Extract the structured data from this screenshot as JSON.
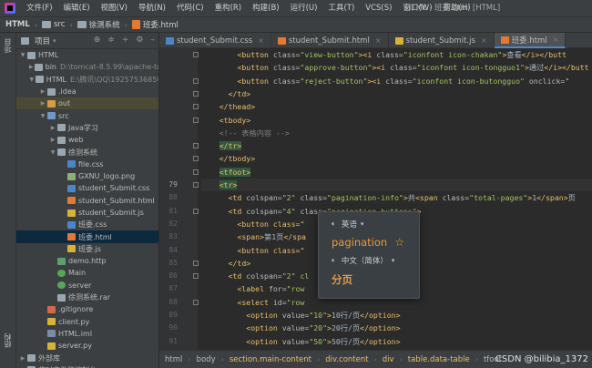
{
  "menubar": {
    "items": [
      "文件(F)",
      "编辑(E)",
      "视图(V)",
      "导航(N)",
      "代码(C)",
      "重构(R)",
      "构建(B)",
      "运行(U)",
      "工具(T)",
      "VCS(S)",
      "窗口(W)",
      "帮助(H)"
    ],
    "window_title": "HTML - 班委.html [HTML]"
  },
  "breadcrumb": [
    "HTML",
    "src",
    "徐测系统",
    "班委.html"
  ],
  "left_strip": {
    "top_label": "项目",
    "bottom_label": "结构"
  },
  "project_panel": {
    "title": "项目",
    "tree": [
      {
        "indent": 0,
        "arrow": "▼",
        "icon": "folder",
        "label": "HTML",
        "extra": "",
        "state": ""
      },
      {
        "indent": 1,
        "arrow": "▶",
        "icon": "folder",
        "label": "bin",
        "extra": "D:\\tomcat-8.5.99\\apache-to",
        "state": ""
      },
      {
        "indent": 1,
        "arrow": "▼",
        "icon": "folder",
        "label": "HTML",
        "extra": "E:\\腾讯\\QQ\\1925753685\\",
        "state": ""
      },
      {
        "indent": 2,
        "arrow": "▶",
        "icon": "folder",
        "label": ".idea",
        "extra": "",
        "state": ""
      },
      {
        "indent": 2,
        "arrow": "▶",
        "icon": "folder-orange",
        "label": "out",
        "extra": "",
        "state": "hl"
      },
      {
        "indent": 2,
        "arrow": "▼",
        "icon": "folder-blue",
        "label": "src",
        "extra": "",
        "state": ""
      },
      {
        "indent": 3,
        "arrow": "▶",
        "icon": "folder",
        "label": "Java学习",
        "extra": "",
        "state": ""
      },
      {
        "indent": 3,
        "arrow": "▶",
        "icon": "folder",
        "label": "web",
        "extra": "",
        "state": ""
      },
      {
        "indent": 3,
        "arrow": "▼",
        "icon": "folder",
        "label": "徐测系统",
        "extra": "",
        "state": ""
      },
      {
        "indent": 4,
        "arrow": "",
        "icon": "css",
        "label": "file.css",
        "extra": "",
        "state": ""
      },
      {
        "indent": 4,
        "arrow": "",
        "icon": "png",
        "label": "GXNU_logo.png",
        "extra": "",
        "state": ""
      },
      {
        "indent": 4,
        "arrow": "",
        "icon": "css",
        "label": "student_Submit.css",
        "extra": "",
        "state": ""
      },
      {
        "indent": 4,
        "arrow": "",
        "icon": "html",
        "label": "student_Submit.html",
        "extra": "",
        "state": ""
      },
      {
        "indent": 4,
        "arrow": "",
        "icon": "js",
        "label": "student_Submit.js",
        "extra": "",
        "state": ""
      },
      {
        "indent": 4,
        "arrow": "",
        "icon": "css",
        "label": "班委.css",
        "extra": "",
        "state": ""
      },
      {
        "indent": 4,
        "arrow": "",
        "icon": "html",
        "label": "班委.html",
        "extra": "",
        "state": "selected"
      },
      {
        "indent": 4,
        "arrow": "",
        "icon": "js",
        "label": "班委.js",
        "extra": "",
        "state": ""
      },
      {
        "indent": 3,
        "arrow": "",
        "icon": "http",
        "label": "demo.http",
        "extra": "",
        "state": ""
      },
      {
        "indent": 3,
        "arrow": "",
        "icon": "run",
        "label": "Main",
        "extra": "",
        "state": ""
      },
      {
        "indent": 3,
        "arrow": "",
        "icon": "run",
        "label": "server",
        "extra": "",
        "state": ""
      },
      {
        "indent": 3,
        "arrow": "",
        "icon": "rar",
        "label": "徐测系统.rar",
        "extra": "",
        "state": ""
      },
      {
        "indent": 2,
        "arrow": "",
        "icon": "git",
        "label": ".gitignore",
        "extra": "",
        "state": ""
      },
      {
        "indent": 2,
        "arrow": "",
        "icon": "js",
        "label": "client.py",
        "extra": "",
        "state": ""
      },
      {
        "indent": 2,
        "arrow": "",
        "icon": "iml",
        "label": "HTML.iml",
        "extra": "",
        "state": ""
      },
      {
        "indent": 2,
        "arrow": "",
        "icon": "js",
        "label": "server.py",
        "extra": "",
        "state": ""
      },
      {
        "indent": 0,
        "arrow": "▶",
        "icon": "folder",
        "label": "外部库",
        "extra": "",
        "state": ""
      },
      {
        "indent": 0,
        "arrow": "",
        "icon": "folder",
        "label": "临时文件和控制台",
        "extra": "",
        "state": ""
      }
    ]
  },
  "tabs": [
    {
      "label": "student_Submit.css",
      "icon": "css",
      "active": false
    },
    {
      "label": "student_Submit.html",
      "icon": "html",
      "active": false
    },
    {
      "label": "student_Submit.js",
      "icon": "js",
      "active": false
    },
    {
      "label": "班委.html",
      "icon": "html",
      "active": true
    }
  ],
  "editor": {
    "current_line": 79,
    "line_numbers": [
      "",
      "",
      "",
      "",
      "",
      "",
      "",
      "",
      "",
      "",
      "79",
      "80",
      "81",
      "82",
      "83",
      "84",
      "85",
      "86",
      "87",
      "88",
      "89",
      "90",
      "91"
    ],
    "lines": [
      [
        [
          "        ",
          "tx"
        ],
        [
          "<button ",
          "tg"
        ],
        [
          "class=",
          "at"
        ],
        [
          "\"view-button\"",
          "av"
        ],
        [
          ">",
          "tg"
        ],
        [
          "<i ",
          "tg"
        ],
        [
          "class=",
          "at"
        ],
        [
          "\"iconfont icon-chakan\"",
          "av"
        ],
        [
          ">",
          "tg"
        ],
        [
          "查看",
          "tx"
        ],
        [
          "</i></butt",
          "tg"
        ]
      ],
      [
        [
          "        ",
          "tx"
        ],
        [
          "<button ",
          "tg"
        ],
        [
          "class=",
          "at"
        ],
        [
          "\"approve-button\"",
          "av"
        ],
        [
          ">",
          "tg"
        ],
        [
          "<i ",
          "tg"
        ],
        [
          "class=",
          "at"
        ],
        [
          "\"iconfont icon-tongguo1\"",
          "av"
        ],
        [
          ">",
          "tg"
        ],
        [
          "通过",
          "tx"
        ],
        [
          "</i></butt",
          "tg"
        ]
      ],
      [
        [
          "        ",
          "tx"
        ],
        [
          "<button ",
          "tg"
        ],
        [
          "class=",
          "at"
        ],
        [
          "\"reject-button\"",
          "av"
        ],
        [
          ">",
          "tg"
        ],
        [
          "<i ",
          "tg"
        ],
        [
          "class=",
          "at"
        ],
        [
          "\"iconfont icon-butongguo\"",
          "av"
        ],
        [
          " onclick=\"",
          "at"
        ]
      ],
      [
        [
          "      ",
          "tx"
        ],
        [
          "</td>",
          "tg"
        ]
      ],
      [
        [
          "    ",
          "tx"
        ],
        [
          "</thead>",
          "tg"
        ]
      ],
      [
        [
          "    ",
          "tx"
        ],
        [
          "<tbody>",
          "tg"
        ]
      ],
      [
        [
          "    ",
          "tx"
        ],
        [
          "<!-- 表格内容 -->",
          "cm"
        ]
      ],
      [
        [
          "    ",
          "tx"
        ],
        [
          "</tr>",
          "tg"
        ]
      ],
      [
        [
          "    ",
          "tx"
        ],
        [
          "</tbody>",
          "tg"
        ]
      ],
      [
        [
          "    ",
          "tx"
        ],
        [
          "<tfoot>",
          "tg"
        ]
      ],
      [
        [
          "    ",
          "tx"
        ],
        [
          "<tr>",
          "tg"
        ]
      ],
      [
        [
          "      ",
          "tx"
        ],
        [
          "<td ",
          "tg"
        ],
        [
          "colspan=",
          "at"
        ],
        [
          "\"2\" ",
          "av"
        ],
        [
          "class=",
          "at"
        ],
        [
          "\"",
          "av"
        ],
        [
          "pagination-info",
          "av"
        ],
        [
          "\"",
          "av"
        ],
        [
          ">",
          "tg"
        ],
        [
          "共",
          "tx"
        ],
        [
          "<span ",
          "tg"
        ],
        [
          "class=",
          "at"
        ],
        [
          "\"total-pages\"",
          "av"
        ],
        [
          ">",
          "tg"
        ],
        [
          "1",
          "tx"
        ],
        [
          "</span>",
          "tg"
        ],
        [
          "页",
          "tx"
        ]
      ],
      [
        [
          "      ",
          "tx"
        ],
        [
          "<td ",
          "tg"
        ],
        [
          "colspan=",
          "at"
        ],
        [
          "\"4\" ",
          "av"
        ],
        [
          "class=",
          "at"
        ],
        [
          "\"pagination-buttons\"",
          "av"
        ],
        [
          ">",
          "tg"
        ]
      ],
      [
        [
          "        ",
          "tx"
        ],
        [
          "<button class=\"",
          "tg"
        ],
        [
          "               ",
          "tx"
        ],
        [
          "Button",
          "av"
        ],
        [
          "\"",
          "av"
        ]
      ],
      [
        [
          "        ",
          "tx"
        ],
        [
          "<span>",
          "tg"
        ],
        [
          "第1页",
          "tx"
        ],
        [
          "</spa",
          "tg"
        ]
      ],
      [
        [
          "        ",
          "tx"
        ],
        [
          "<button class=\"",
          "tg"
        ],
        [
          "               ",
          "tx"
        ],
        [
          "Button",
          "av"
        ],
        [
          "\"",
          "av"
        ]
      ],
      [
        [
          "      ",
          "tx"
        ],
        [
          "</td>",
          "tg"
        ]
      ],
      [
        [
          "      ",
          "tx"
        ],
        [
          "<td ",
          "tg"
        ],
        [
          "colspan=",
          "at"
        ],
        [
          "\"2\" cl",
          "av"
        ]
      ],
      [
        [
          "        ",
          "tx"
        ],
        [
          "<label ",
          "tg"
        ],
        [
          "for=",
          "at"
        ],
        [
          "\"row",
          "av"
        ],
        [
          "                ",
          "tx"
        ],
        [
          "label>",
          "tg"
        ]
      ],
      [
        [
          "        ",
          "tx"
        ],
        [
          "<select ",
          "tg"
        ],
        [
          "id=",
          "at"
        ],
        [
          "\"row",
          "av"
        ]
      ],
      [
        [
          "          ",
          "tx"
        ],
        [
          "<option ",
          "tg"
        ],
        [
          "value=",
          "at"
        ],
        [
          "\"10\"",
          "av"
        ],
        [
          ">",
          "tg"
        ],
        [
          "10行/页",
          "tx"
        ],
        [
          "</option>",
          "tg"
        ]
      ],
      [
        [
          "          ",
          "tx"
        ],
        [
          "<option ",
          "tg"
        ],
        [
          "value=",
          "at"
        ],
        [
          "\"20\"",
          "av"
        ],
        [
          ">",
          "tg"
        ],
        [
          "20行/页",
          "tx"
        ],
        [
          "</option>",
          "tg"
        ]
      ],
      [
        [
          "          ",
          "tx"
        ],
        [
          "<option ",
          "tg"
        ],
        [
          "value=",
          "at"
        ],
        [
          "\"50\"",
          "av"
        ],
        [
          ">",
          "tg"
        ],
        [
          "50行/页",
          "tx"
        ],
        [
          "</option>",
          "tg"
        ]
      ],
      [
        [
          "        ",
          "tx"
        ],
        [
          "</select>",
          "tg"
        ]
      ]
    ]
  },
  "statusbar": {
    "path": [
      "html",
      "body",
      "section.main-content",
      "div.content",
      "div",
      "table.data-table",
      "tfoot"
    ],
    "watermark": "CSDN @bilibia_1372"
  },
  "translate_popup": {
    "source_lang": "英语",
    "word": "pagination",
    "target_lang": "中文（简体）",
    "result": "分页"
  }
}
